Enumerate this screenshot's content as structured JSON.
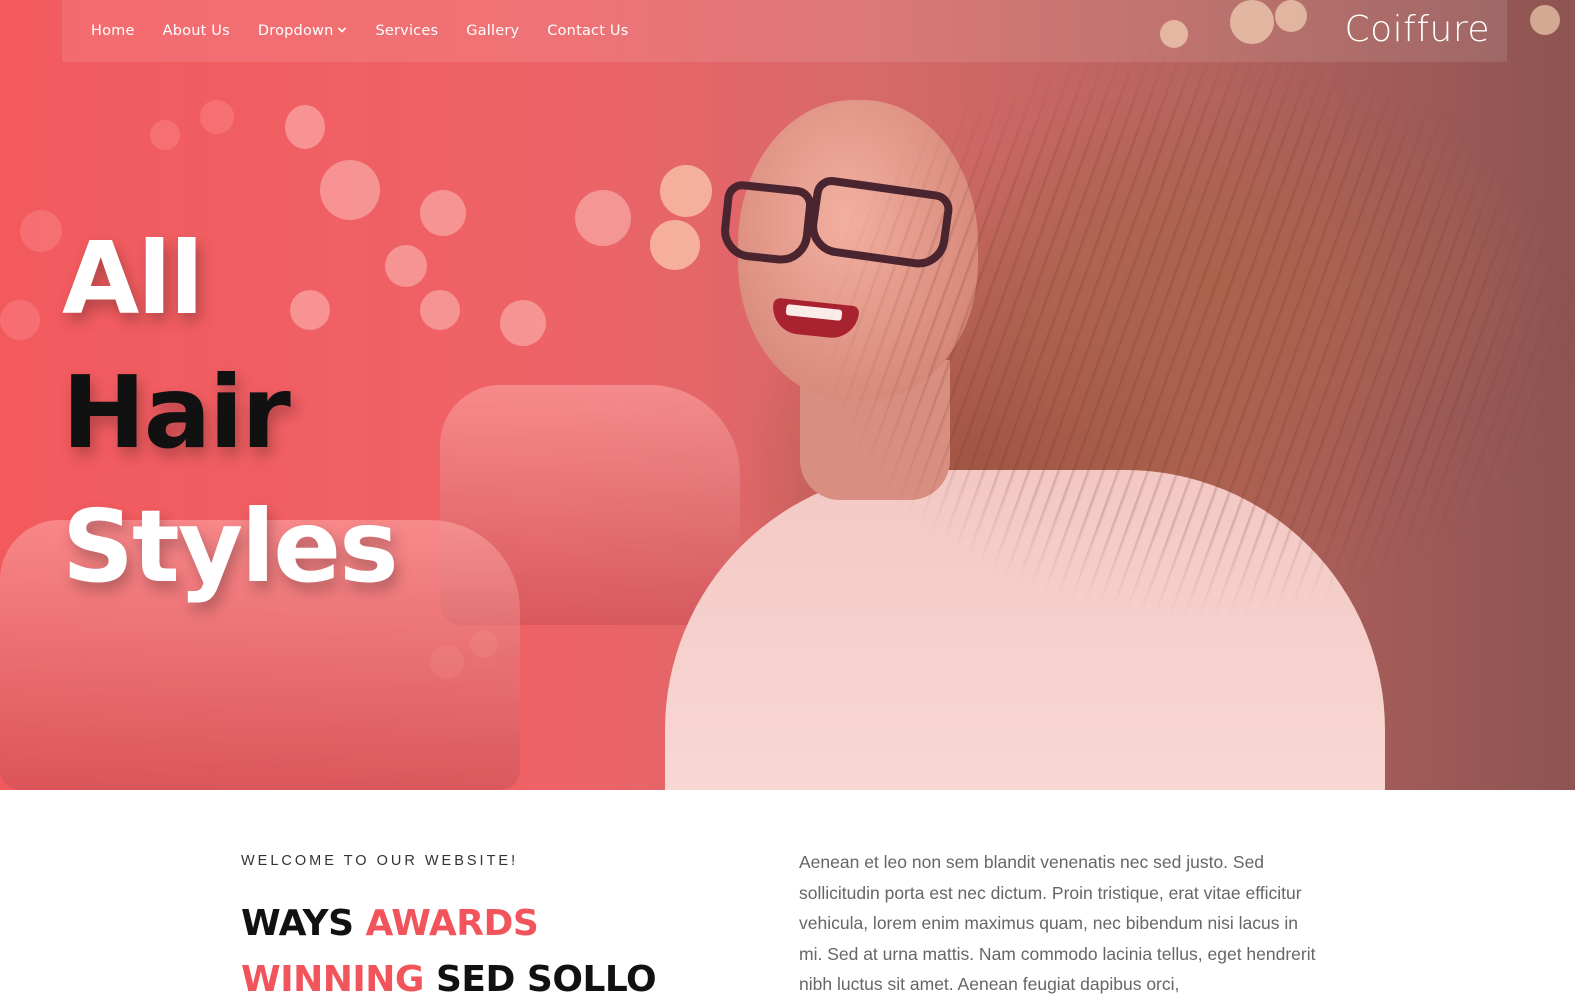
{
  "nav": {
    "items": [
      {
        "label": "Home"
      },
      {
        "label": "About Us"
      },
      {
        "label": "Dropdown"
      },
      {
        "label": "Services"
      },
      {
        "label": "Gallery"
      },
      {
        "label": "Contact Us"
      }
    ],
    "brand": "Coiffure"
  },
  "hero": {
    "line1": "All",
    "line2": "Hair",
    "line3": "Styles"
  },
  "welcome": {
    "tag": "WELCOME TO OUR WEBSITE!",
    "heading_part1": "WAYS ",
    "heading_accent1": "AWARDS",
    "heading_accent2": "WINNING",
    "heading_part2": " SED SOLLO",
    "paragraph": "Aenean et leo non sem blandit venenatis nec sed justo. Sed sollicitudin porta est nec dictum. Proin tristique, erat vitae efficitur vehicula, lorem enim maximus quam, nec bibendum nisi lacus in mi. Sed at urna mattis. Nam commodo lacinia tellus, eget hendrerit nibh luctus sit amet. Aenean feugiat dapibus orci,"
  },
  "colors": {
    "accent": "#f2545b",
    "hero_overlay": "#ee6367",
    "headline_dark": "#111111"
  },
  "icons": {
    "dropdown": "chevron-down-icon"
  }
}
